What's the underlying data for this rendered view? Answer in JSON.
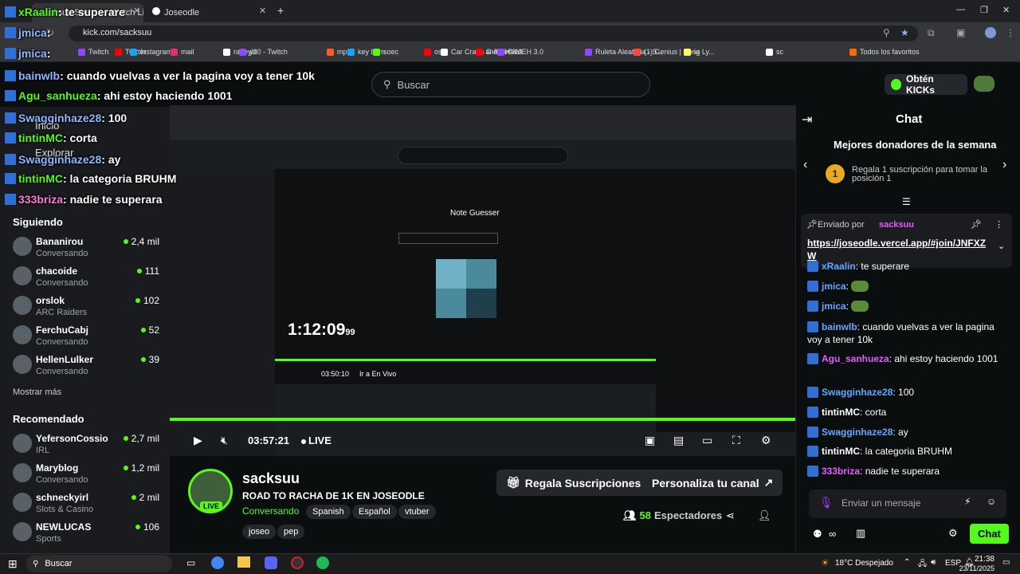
{
  "browser": {
    "tabs": [
      {
        "label": "sacksuu Stream - Watch Live on Kick",
        "active": true
      },
      {
        "label": "Joseodle",
        "active": false
      }
    ],
    "url": "kick.com/sacksuu",
    "bookmarks": [
      "Twitch",
      "Twitter",
      "Instagram",
      "mail",
      "rageylo0 - Twitch",
      "y2",
      "mp3",
      "key bpm",
      "soec",
      "os",
      "Car Crash and Siren...",
      "G-MEH 3.0",
      "G-MEH 3.0",
      "Ruleta Aleatoria - S...",
      "(1) Genius | Song Ly...",
      "ia",
      "sc",
      "Todos los favoritos"
    ],
    "bookmark_colors": [
      "#9146ff",
      "#ff0000",
      "#1da1f2",
      "#e1306c",
      "#ffffff",
      "#9146ff",
      "#ff5a1f",
      "#1da1f2",
      "#53fc18",
      "#ff0000",
      "#ffffff",
      "#ff0000",
      "#9146ff",
      "#9146ff",
      "#ff4444",
      "#ffff64",
      "#ffffff",
      "#ff6a00",
      "#ffd54f"
    ]
  },
  "header": {
    "search_placeholder": "Buscar",
    "kicks_button": "Obtén KICKs"
  },
  "sidebar": {
    "nav": [
      "Inicio",
      "Explorar",
      "Siguiendo"
    ],
    "following_title": "Siguiendo",
    "following": [
      {
        "name": "Bananirou",
        "sub": "Conversando",
        "count": "2,4 mil"
      },
      {
        "name": "chacoide",
        "sub": "Conversando",
        "count": "111"
      },
      {
        "name": "orslok",
        "sub": "ARC Raiders",
        "count": "102"
      },
      {
        "name": "FerchuCabj",
        "sub": "Conversando",
        "count": "52"
      },
      {
        "name": "HellenLulker",
        "sub": "Conversando",
        "count": "39"
      }
    ],
    "show_more": "Mostrar más",
    "recommended_title": "Recomendado",
    "recommended": [
      {
        "name": "YefersonCossio",
        "sub": "IRL",
        "count": "2,7 mil"
      },
      {
        "name": "Maryblog",
        "sub": "Conversando",
        "count": "1,2 mil"
      },
      {
        "name": "schneckyirl",
        "sub": "Slots & Casino",
        "count": "2 mil"
      },
      {
        "name": "NEWLUCAS",
        "sub": "Sports",
        "count": "106"
      }
    ]
  },
  "overlay": [
    {
      "user": "xRaalin",
      "text": "te superare",
      "color": "u2"
    },
    {
      "user": "jmica",
      "text": "",
      "color": "u1"
    },
    {
      "user": "jmica",
      "text": "",
      "color": "u1"
    },
    {
      "user": "bainwlb",
      "text": "cuando vuelvas a ver la pagina voy a tener 10k",
      "color": "u1"
    },
    {
      "user": "Agu_sanhueza",
      "text": "ahi estoy haciendo 1001",
      "color": "u2"
    },
    {
      "user": "Swagginhaze28",
      "text": "100",
      "color": "u1"
    },
    {
      "user": "tintinMC",
      "text": "corta",
      "color": "u2"
    },
    {
      "user": "Swagginhaze28",
      "text": "ay",
      "color": "u1"
    },
    {
      "user": "tintinMC",
      "text": "la categoria BRUHM",
      "color": "u2"
    },
    {
      "user": "333briza",
      "text": "nadie te superara",
      "color": "u3"
    }
  ],
  "player": {
    "inner_title": "Note Guesser",
    "timer": "1:12:09",
    "timer_ms": "99",
    "inner_elapsed": "03:50:10",
    "inner_live": "Ir a En Vivo",
    "elapsed": "03:57:21",
    "live_label": "LIVE"
  },
  "stream": {
    "name": "sacksuu",
    "title": "ROAD TO RACHA DE 1K EN JOSEODLE",
    "category": "Conversando",
    "tags": [
      "Spanish",
      "Español",
      "vtuber"
    ],
    "tags2": [
      "joseo",
      "pep"
    ],
    "live_badge": "LIVE",
    "viewers": "58",
    "viewers_label": "Espectadores",
    "sub_button": "Regala Suscripciones",
    "custom_button": "Personaliza tu canal"
  },
  "chat": {
    "title": "Chat",
    "donors_title": "Mejores donadores de la semana",
    "donor_rank": "1",
    "donor_text": "Regala 1 suscripción para tomar la posición 1",
    "pinned_by": "Enviado por",
    "pinned_user": "sacksuu",
    "pinned_link": "https://joseodle.vercel.app/#join/JNFXZW",
    "messages": [
      {
        "user": "xRaalin",
        "text": "te superare",
        "color": "user"
      },
      {
        "user": "jmica",
        "text": "",
        "color": "user"
      },
      {
        "user": "jmica",
        "text": "",
        "color": "user"
      },
      {
        "user": "bainwlb",
        "text": "cuando vuelvas a ver la pagina voy a tener 10k",
        "color": "user"
      },
      {
        "user": "Agu_sanhueza",
        "text": "ahi estoy haciendo 1001",
        "color": "user-p"
      },
      {
        "user": "Swagginhaze28",
        "text": "100",
        "color": "user"
      },
      {
        "user": "tintinMC",
        "text": "corta",
        "color": "user-w"
      },
      {
        "user": "Swagginhaze28",
        "text": "ay",
        "color": "user"
      },
      {
        "user": "tintinMC",
        "text": "la categoria BRUHM",
        "color": "user-w"
      },
      {
        "user": "333briza",
        "text": "nadie te superara",
        "color": "user-p"
      }
    ],
    "input_placeholder": "Enviar un mensaje",
    "send_button": "Chat"
  },
  "taskbar": {
    "search": "Buscar",
    "weather": "18°C  Despejado",
    "lang": "ESP",
    "time": "21:38",
    "date": "23/11/2025"
  }
}
